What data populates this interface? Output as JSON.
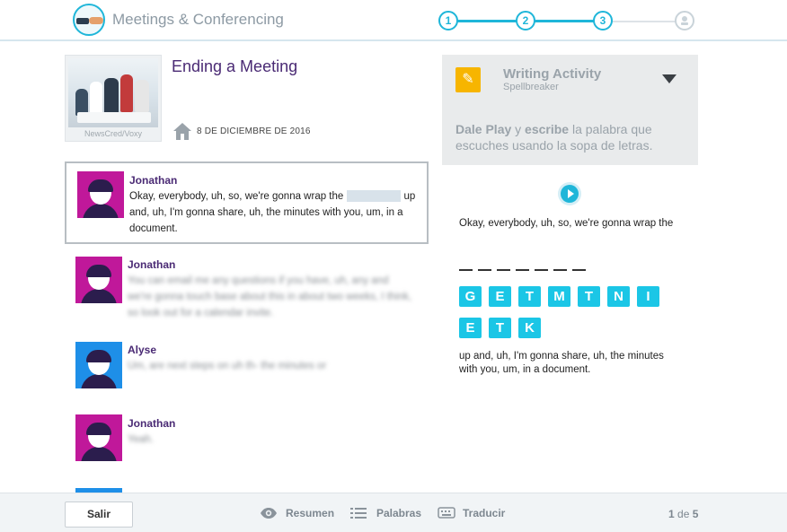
{
  "app": {
    "title": "Meetings & Conferencing"
  },
  "progress": {
    "steps": [
      "1",
      "2",
      "3"
    ],
    "current": 3,
    "total": 4
  },
  "lesson": {
    "title": "Ending a Meeting",
    "image_credit": "NewsCred/Voxy",
    "date": "8 DE DICIEMBRE DE 2016"
  },
  "transcript": [
    {
      "speaker": "Jonathan",
      "text_before": "Okay, everybody, uh, so, we're gonna wrap the",
      "text_after": "up and, uh, I'm gonna share, uh, the minutes with you, um, in a document."
    },
    {
      "speaker": "Jonathan",
      "text": "You can email me any questions if you have, uh, any and we're gonna touch base about this in about two weeks, I think, so look out for a calendar invite."
    },
    {
      "speaker": "Alyse",
      "text": "Um, are next steps on uh th- the minutes or"
    },
    {
      "speaker": "Jonathan",
      "text": "Yeah."
    }
  ],
  "activity": {
    "title": "Writing Activity",
    "subtitle": "Spellbreaker",
    "instruction_play": "Dale Play",
    "instruction_mid1": " y ",
    "instruction_write": "escribe",
    "instruction_rest": " la palabra que escuches usando la sopa de letras.",
    "clip_before": "Okay, everybody, uh, so, we're gonna wrap the",
    "clip_after": "up and, uh, I'm gonna share, uh, the minutes with you, um, in a document.",
    "blank_count": 7,
    "letters": [
      "G",
      "E",
      "T",
      "M",
      "T",
      "N",
      "I",
      "E",
      "T",
      "K"
    ]
  },
  "footer": {
    "exit_label": "Salir",
    "summary_label": "Resumen",
    "words_label": "Palabras",
    "translate_label": "Traducir",
    "page_current": "1",
    "page_sep": " de ",
    "page_total": "5"
  },
  "colors": {
    "accent": "#1fb6d9",
    "tile": "#1bc6e6",
    "title": "#4a2a74",
    "avatar_magenta": "#c0189a",
    "avatar_blue": "#1e8fe8"
  }
}
